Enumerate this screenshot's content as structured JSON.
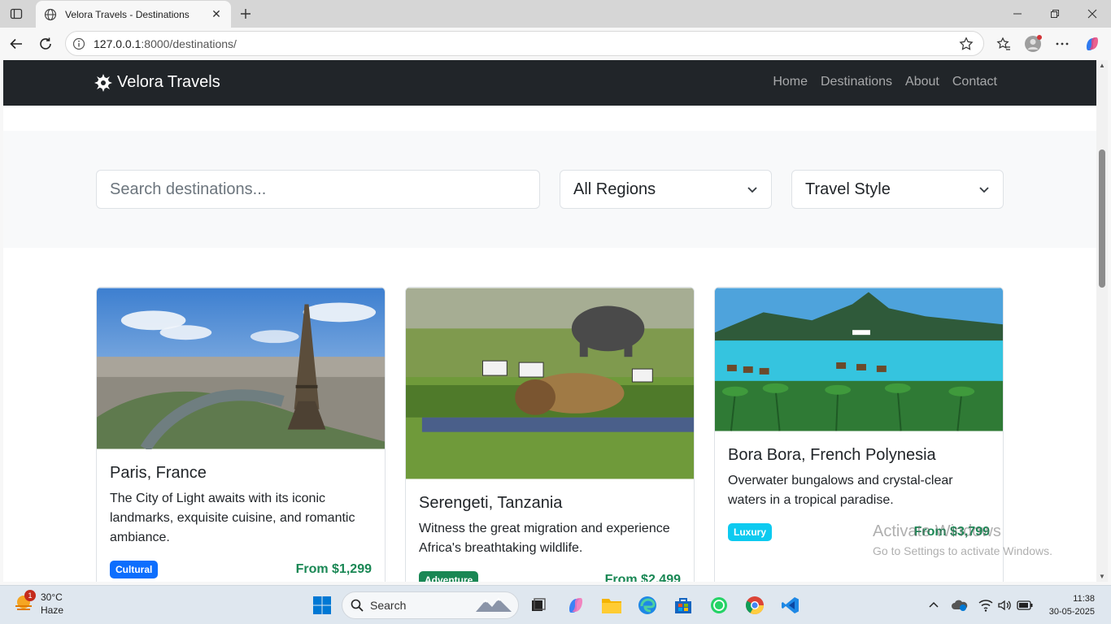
{
  "browser": {
    "tab_title": "Velora Travels - Destinations",
    "url_host": "127.0.0.1",
    "url_rest": ":8000/destinations/"
  },
  "site": {
    "brand": "Velora Travels",
    "nav": [
      "Home",
      "Destinations",
      "About",
      "Contact"
    ]
  },
  "filters": {
    "search_placeholder": "Search destinations...",
    "region_value": "All Regions",
    "style_value": "Travel Style"
  },
  "destinations": [
    {
      "title": "Paris, France",
      "description": "The City of Light awaits with its iconic landmarks, exquisite cuisine, and romantic ambiance.",
      "badge": "Cultural",
      "badge_color": "#0d6efd",
      "price": "From $1,299"
    },
    {
      "title": "Serengeti, Tanzania",
      "description": "Witness the great migration and experience Africa's breathtaking wildlife.",
      "badge": "Adventure",
      "badge_color": "#198754",
      "price": "From $2,499"
    },
    {
      "title": "Bora Bora, French Polynesia",
      "description": "Overwater bungalows and crystal-clear waters in a tropical paradise.",
      "badge": "Luxury",
      "badge_color": "#0dcaf0",
      "price": "From $3,799"
    }
  ],
  "watermark": {
    "line1": "Activate Windows",
    "line2": "Go to Settings to activate Windows."
  },
  "taskbar": {
    "temp": "30°C",
    "condition": "Haze",
    "weather_badge": "1",
    "search_label": "Search",
    "time": "11:38",
    "date": "30-05-2025"
  }
}
